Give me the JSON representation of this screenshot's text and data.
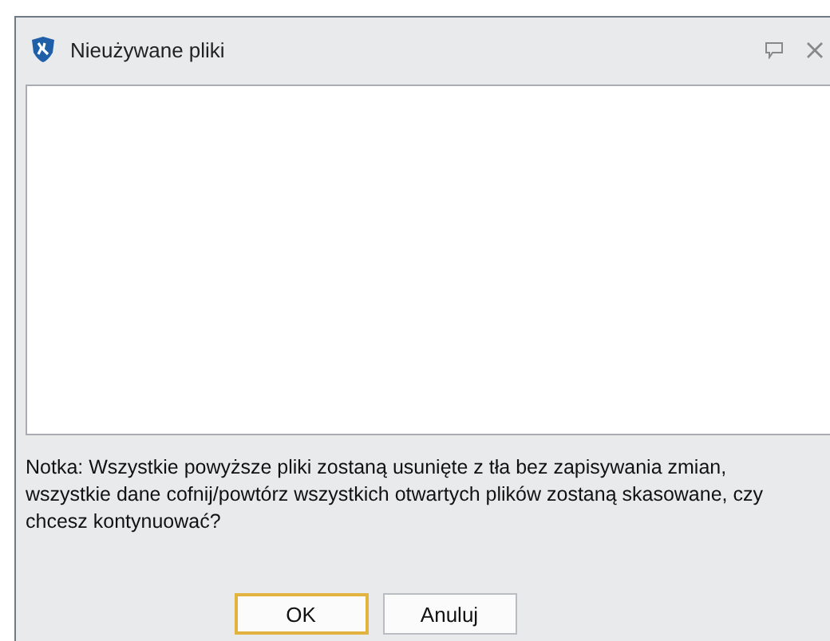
{
  "window": {
    "title": "Nieużywane pliki"
  },
  "note": "Notka: Wszystkie powyższe pliki zostaną usunięte z tła bez zapisywania zmian, wszystkie dane cofnij/powtórz wszystkich otwartych plików zostaną skasowane, czy chcesz kontynuować?",
  "buttons": [
    {
      "label": "OK",
      "default": true
    },
    {
      "label": "Anuluj",
      "default": false
    }
  ]
}
